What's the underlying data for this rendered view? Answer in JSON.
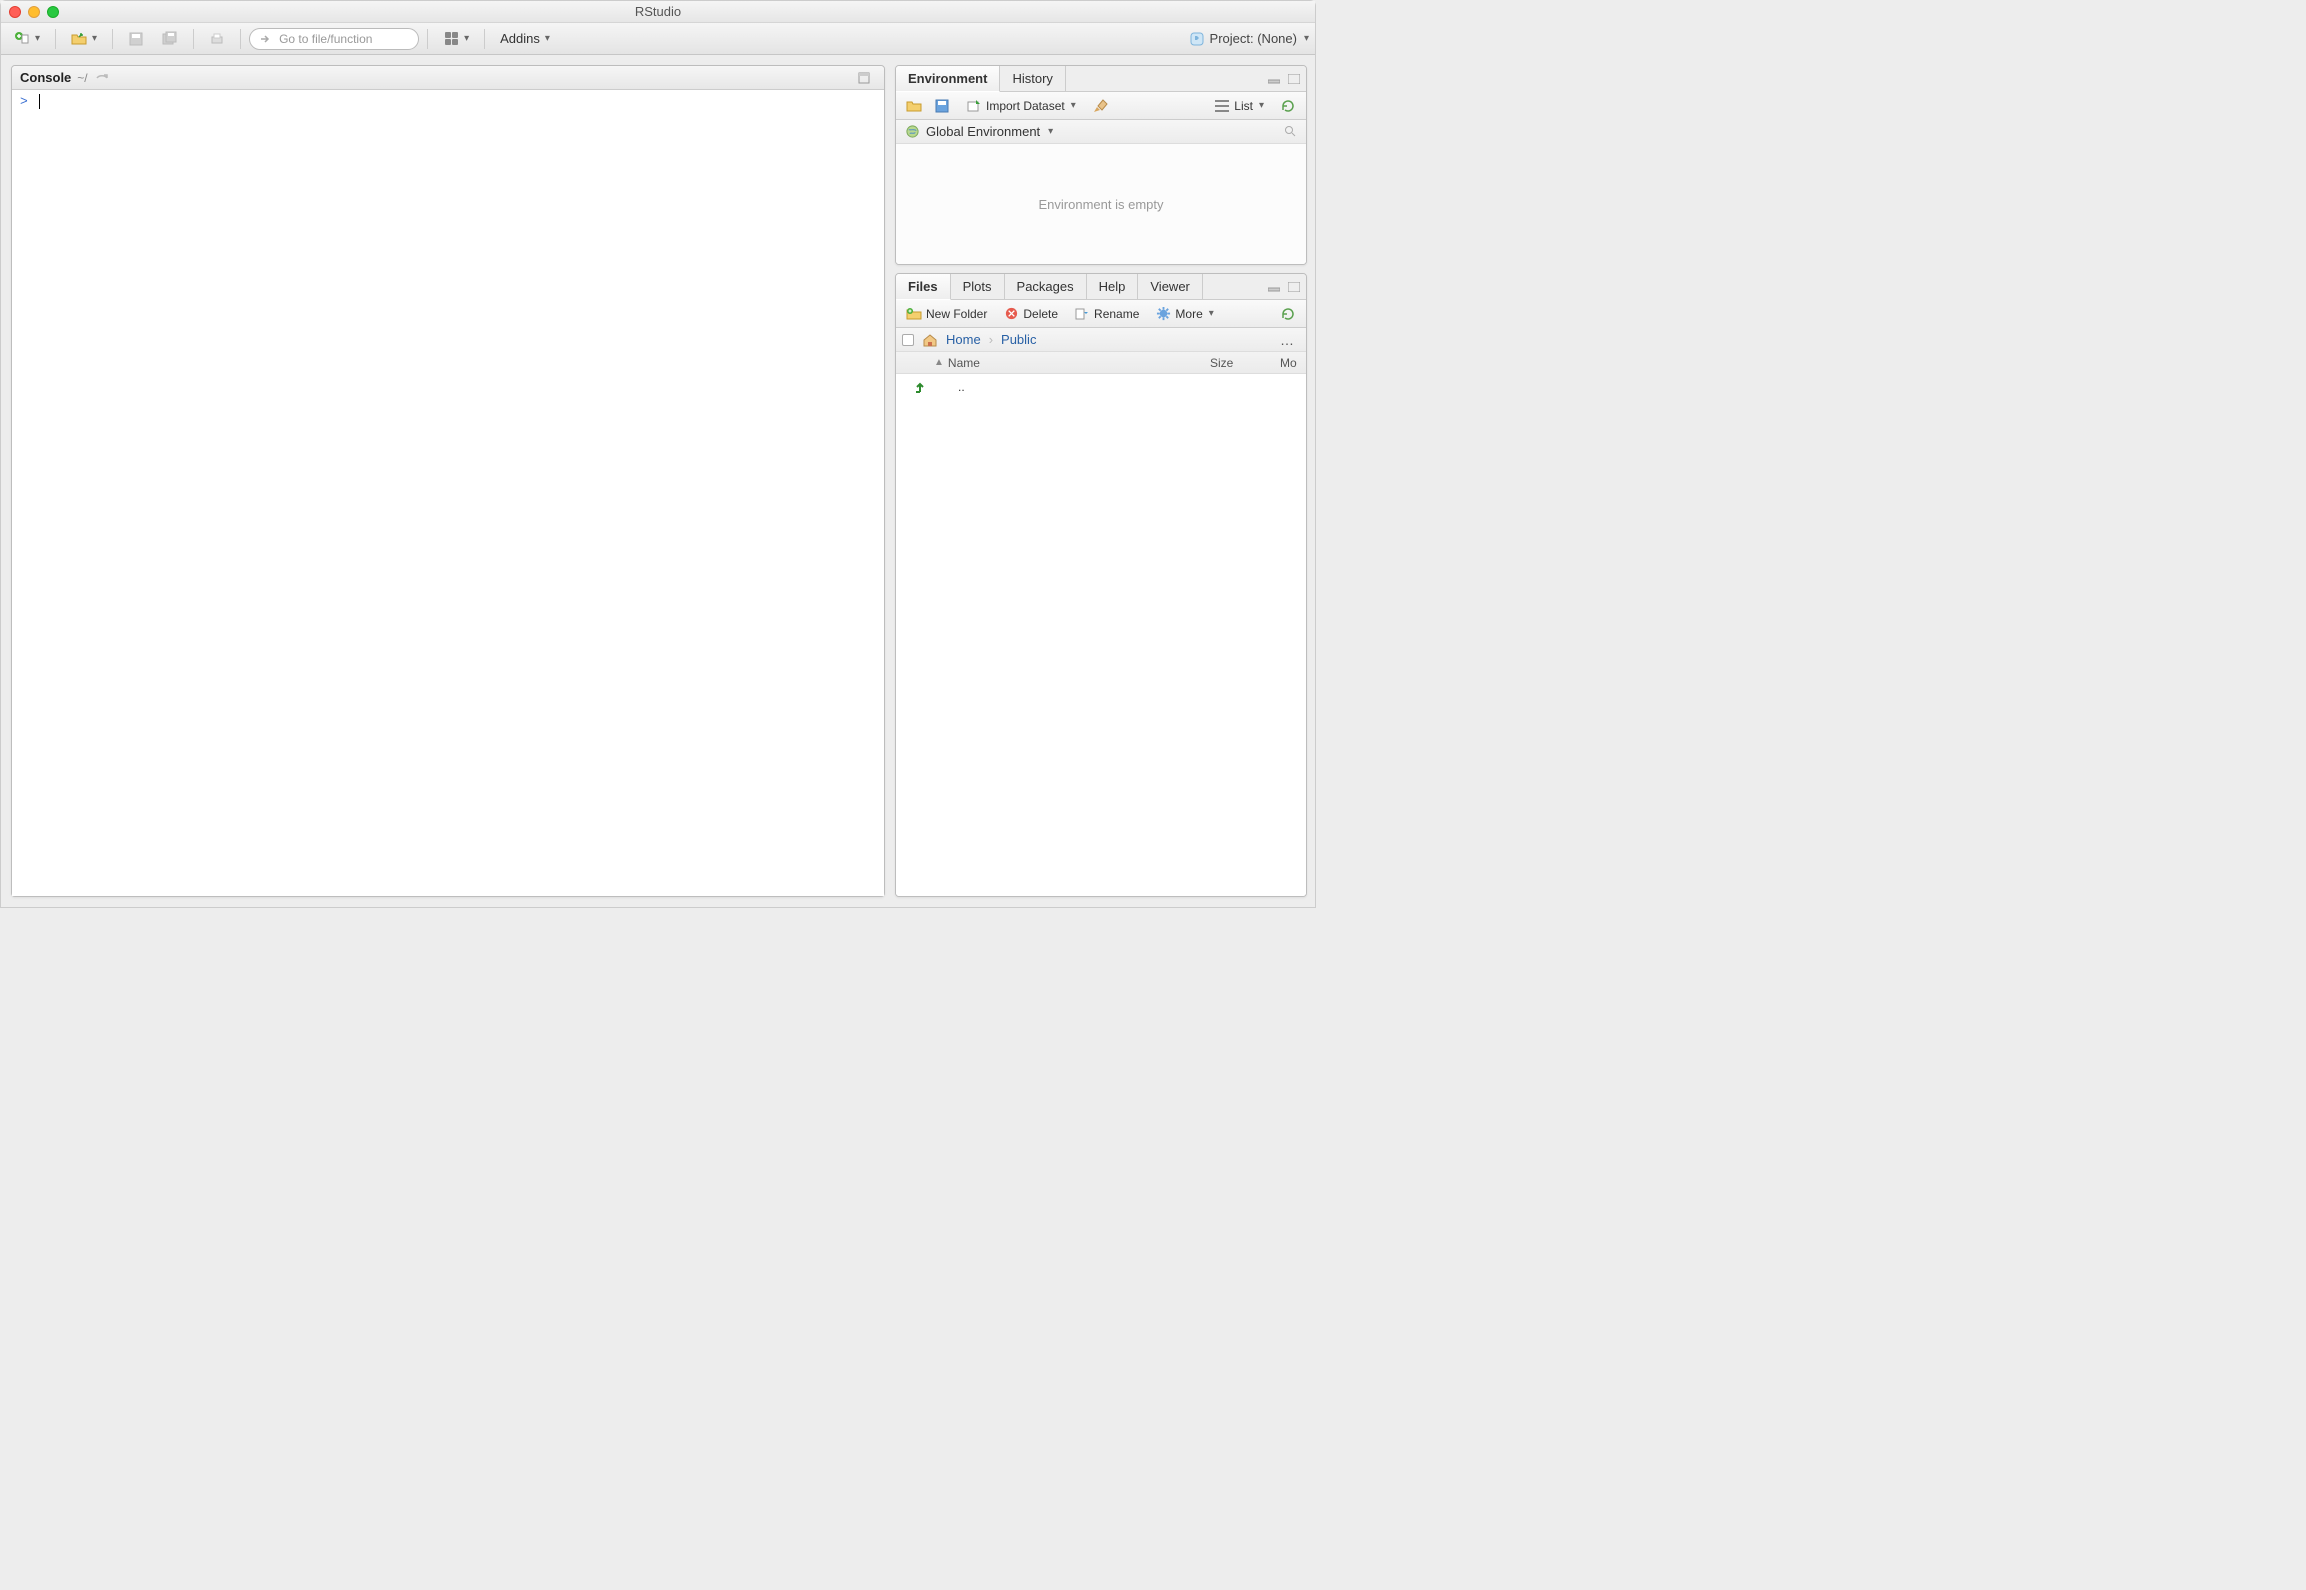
{
  "window": {
    "title": "RStudio"
  },
  "toolbar": {
    "goto_placeholder": "Go to file/function",
    "addins_label": "Addins",
    "project_label": "Project: (None)"
  },
  "console": {
    "title": "Console",
    "path": "~/",
    "prompt": ">"
  },
  "env_pane": {
    "tabs": [
      "Environment",
      "History"
    ],
    "active_tab": 0,
    "import_label": "Import Dataset",
    "list_label": "List",
    "scope_label": "Global Environment",
    "empty_text": "Environment is empty"
  },
  "files_pane": {
    "tabs": [
      "Files",
      "Plots",
      "Packages",
      "Help",
      "Viewer"
    ],
    "active_tab": 0,
    "new_folder": "New Folder",
    "delete": "Delete",
    "rename": "Rename",
    "more": "More",
    "breadcrumbs": [
      "Home",
      "Public"
    ],
    "columns": {
      "name": "Name",
      "size": "Size",
      "modified": "Mo"
    },
    "up_entry": ".."
  }
}
